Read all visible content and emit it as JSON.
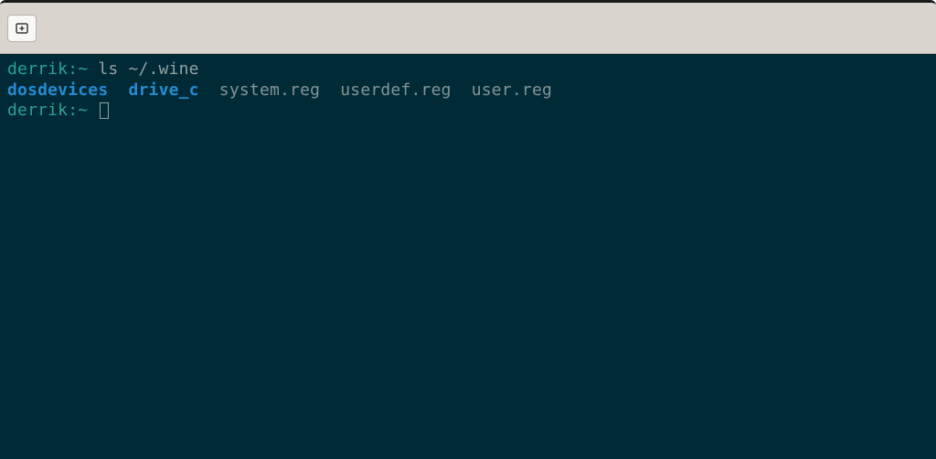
{
  "titlebar": {
    "new_tab_icon": "new-tab"
  },
  "terminal": {
    "lines": [
      {
        "prompt": "derrik:~",
        "command": " ls ~/.wine"
      },
      {
        "entries": [
          {
            "name": "dosdevices",
            "type": "dir"
          },
          {
            "name": "drive_c",
            "type": "dir"
          },
          {
            "name": "system.reg",
            "type": "file"
          },
          {
            "name": "userdef.reg",
            "type": "file"
          },
          {
            "name": "user.reg",
            "type": "file"
          }
        ]
      },
      {
        "prompt": "derrik:~",
        "cursor": true
      }
    ]
  },
  "colors": {
    "bg": "#002b36",
    "prompt": "#2aa198",
    "dir": "#268bd2",
    "file": "#839496",
    "text": "#93a1a1",
    "titlebar": "#d9d4ce"
  }
}
